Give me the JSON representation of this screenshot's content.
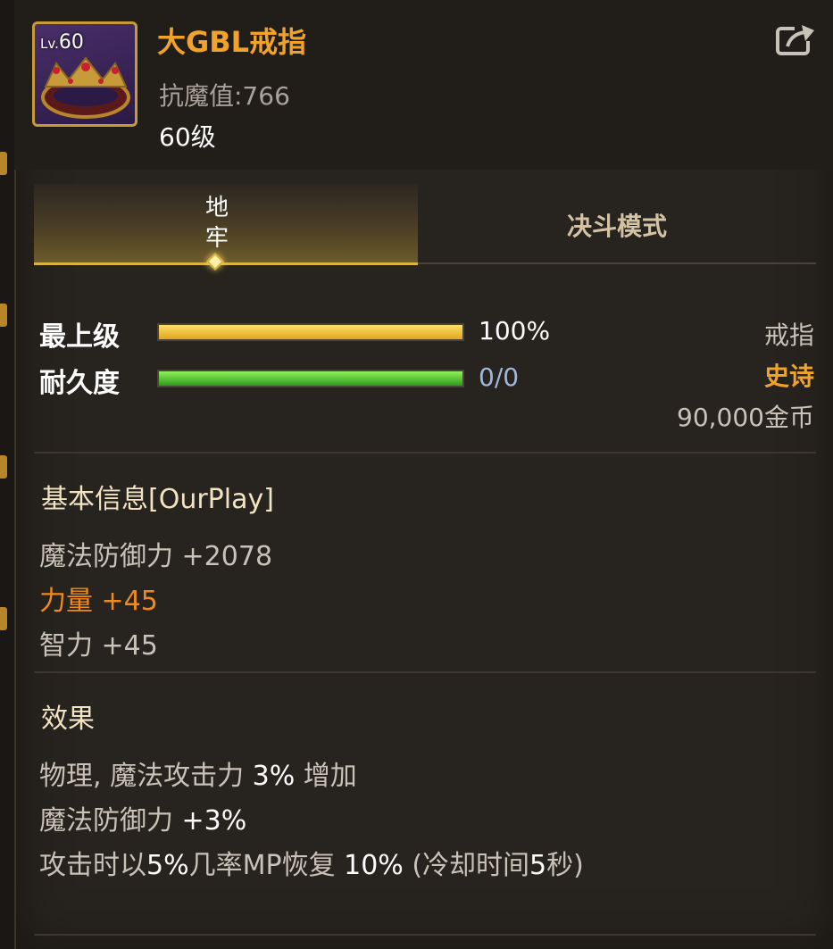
{
  "item": {
    "level_badge_prefix": "Lv.",
    "level_badge_value": "60",
    "name": "大GBL戒指",
    "resistance": "抗魔值:766",
    "required_level": "60级",
    "icon": "golden-ring-icon"
  },
  "tabs": [
    {
      "label": "地牢",
      "active": true
    },
    {
      "label": "决斗模式",
      "active": false
    }
  ],
  "bars": {
    "grade": {
      "label": "最上级",
      "value_text": "100%",
      "fill": 1.0,
      "color": "#f2c22c"
    },
    "durability": {
      "label": "耐久度",
      "value_text": "0/0",
      "fill": 1.0,
      "color": "#58d12e",
      "value_color": "#9fb7d8"
    }
  },
  "side_info": {
    "type": "戒指",
    "rarity": "史诗",
    "price": "90,000金币"
  },
  "basic_info": {
    "title": "基本信息[OurPlay]",
    "stats": [
      {
        "name": "魔法防御力",
        "value": "+2078",
        "highlight": false
      },
      {
        "name": "力量",
        "value": "+45",
        "highlight": true
      },
      {
        "name": "智力",
        "value": "+45",
        "highlight": false
      }
    ]
  },
  "effects": {
    "title": "效果",
    "line1": {
      "pre": "物理, 魔法攻击力 ",
      "hl1": "3%",
      "post": " 增加"
    },
    "line2": {
      "pre": "魔法防御力 ",
      "hl1": "+3%"
    },
    "line3": {
      "pre": "攻击时以",
      "hl1": "5%",
      "mid1": "几率MP恢复 ",
      "hl2": "10%",
      "mid2": " (冷却时间",
      "hl3": "5",
      "post": "秒)"
    }
  },
  "colors": {
    "rarity_epic": "#f0a22b",
    "accent_gold": "#d9b240",
    "highlight_stat": "#f08a1c"
  },
  "share_icon": "share-export-icon"
}
